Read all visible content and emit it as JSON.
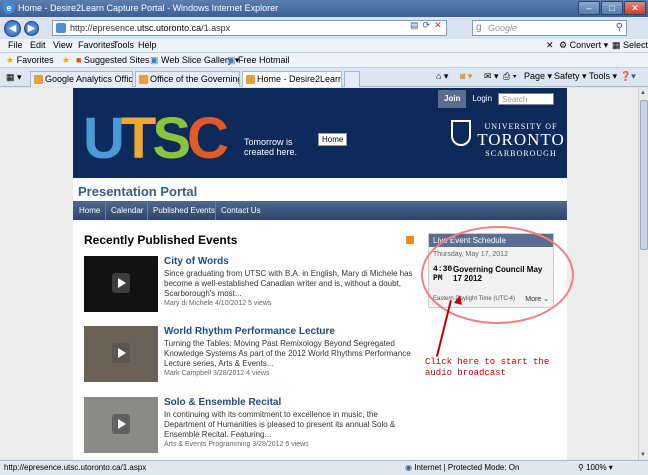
{
  "window": {
    "title": "Home - Desire2Learn Capture Portal - Windows Internet Explorer"
  },
  "address": {
    "url_prefix": "http://epresence.",
    "url_domain": "utsc.utoronto.ca",
    "url_suffix": "/1.aspx",
    "search_placeholder": "Google"
  },
  "menu": [
    "File",
    "Edit",
    "View",
    "Favorites",
    "Tools",
    "Help"
  ],
  "menu_right": {
    "convert": "Convert",
    "select": "Select"
  },
  "favbar": {
    "favorites": "Favorites",
    "suggested": "Suggested Sites ▾",
    "webslice": "Web Slice Gallery ▾",
    "hotmail": "Free Hotmail"
  },
  "tabs": [
    {
      "label": "Google Analytics Official ..."
    },
    {
      "label": "Office of the Governing C..."
    },
    {
      "label": "Home - Desire2Learn C..."
    }
  ],
  "cmd": {
    "page": "Page ▾",
    "safety": "Safety ▾",
    "tools": "Tools ▾"
  },
  "site": {
    "utsc": [
      "U",
      "T",
      "S",
      "C"
    ],
    "tagline": "Tomorrow is created here.",
    "home_pill": "Home",
    "join": "Join",
    "login": "Login",
    "search": "Search",
    "uoft_1": "UNIVERSITY OF",
    "uoft_2": "TORONTO",
    "uoft_3": "SCARBOROUGH",
    "portal_title": "Presentation Portal",
    "nav": [
      "Home",
      "Calendar",
      "Published Events",
      "Contact Us"
    ],
    "recent_heading": "Recently Published Events",
    "events": [
      {
        "title": "City of Words",
        "desc": "Since graduating from UTSC with B.A. in English, Mary di Michele has become a well-established Canadian writer and is, without a doubt, Scarborough's most...",
        "meta": "Mary di Michele    4/10/2012    5 views"
      },
      {
        "title": "World Rhythm Performance Lecture",
        "desc": "Turning the Tables: Moving Past Remixology Beyond Segregated Knowledge Systems As part of the 2012 World Rhythms Performance Lecture series, Arts & Events...",
        "meta": "Mark Campbell    3/28/2012    4 views"
      },
      {
        "title": "Solo & Ensemble Recital",
        "desc": "In continuing with its commitment to excellence in music, the Department of Humanities is pleased to present its annual Solo & Ensemble Recital. Featuring...",
        "meta": "Arts & Events Programming    3/28/2012    5 views"
      }
    ],
    "schedule": {
      "heading": "Live Event Schedule",
      "date": "Thursday, May 17, 2012",
      "time": "4:30 PM",
      "event": "Governing Council May 17 2012",
      "timezone": "Eastern Daylight Time (UTC-4)",
      "more": "More ⌄"
    },
    "annotation": "Click here to start the audio broadcast"
  },
  "status": {
    "url": "http://epresence.utsc.utoronto.ca/1.aspx",
    "zone": "Internet | Protected Mode: On",
    "zoom": "100%"
  }
}
